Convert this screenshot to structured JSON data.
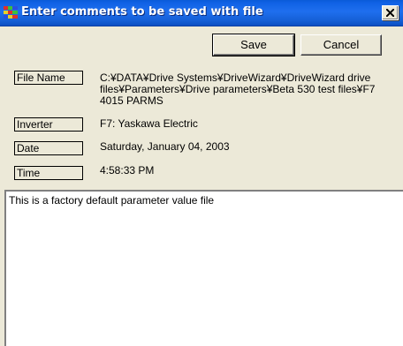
{
  "window": {
    "title": "Enter comments to be saved with file"
  },
  "buttons": {
    "save_label": "Save",
    "cancel_label": "Cancel"
  },
  "fields": {
    "file_name_label": "File Name",
    "file_name_value_line1": "C:¥DATA¥Drive Systems¥DriveWizard¥DriveWizard drive",
    "file_name_value_line2": "files¥Parameters¥Drive parameters¥Beta 530 test files¥F7",
    "file_name_value_line3": "4015 PARMS",
    "inverter_label": "Inverter",
    "inverter_value": "F7: Yaskawa Electric",
    "date_label": "Date",
    "date_value": "Saturday, January 04, 2003",
    "time_label": "Time",
    "time_value": "4:58:33 PM"
  },
  "comments": {
    "text": "This is a factory default parameter value file"
  }
}
